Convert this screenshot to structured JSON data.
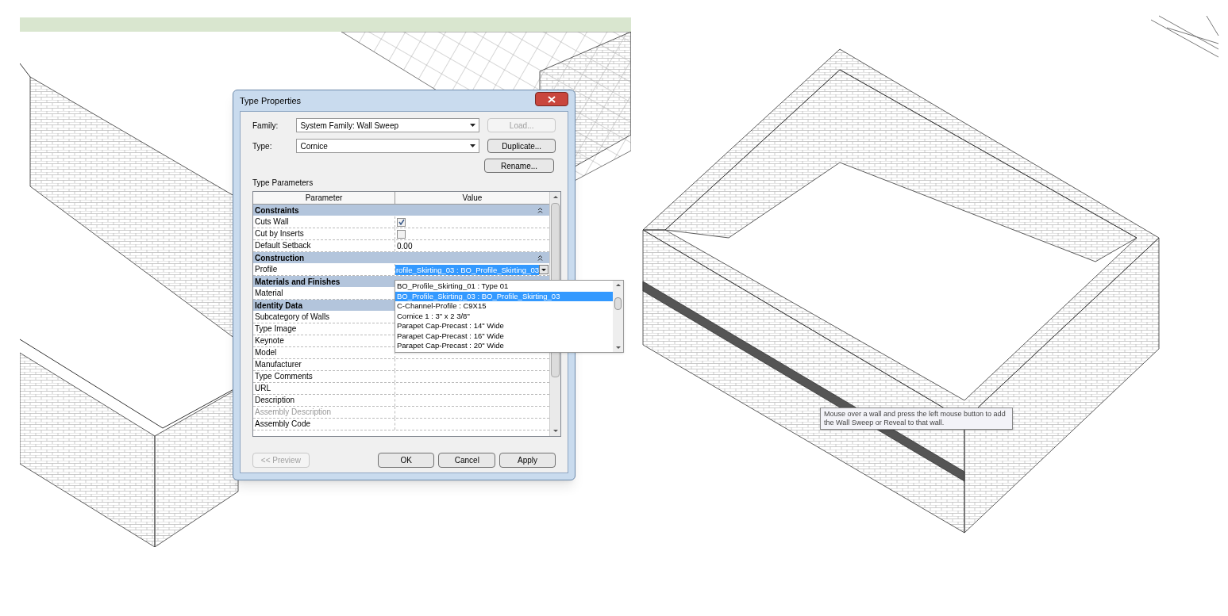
{
  "dialog": {
    "title": "Type Properties",
    "family": {
      "label": "Family:",
      "value": "System Family: Wall Sweep"
    },
    "type": {
      "label": "Type:",
      "value": "Cornice"
    },
    "buttons": [
      {
        "label": "Load...",
        "disabled": true
      },
      {
        "label": "Duplicate...",
        "disabled": false
      },
      {
        "label": "Rename...",
        "disabled": false
      }
    ],
    "section_label": "Type Parameters",
    "table": {
      "columns": [
        "Parameter",
        "Value"
      ],
      "rows": [
        {
          "kind": "group",
          "name": "Constraints",
          "expanded": true,
          "disabled": false
        },
        {
          "kind": "checkbox",
          "name": "Cuts Wall",
          "checked": true,
          "disabled": false
        },
        {
          "kind": "checkbox",
          "name": "Cut by Inserts",
          "checked": false,
          "disabled": false
        },
        {
          "kind": "text",
          "name": "Default Setback",
          "value": "0.00",
          "disabled": false
        },
        {
          "kind": "group",
          "name": "Construction",
          "expanded": true,
          "disabled": false
        },
        {
          "kind": "dropdown",
          "name": "Profile",
          "value": "rofile_Skirting_03 : BO_Profile_Skirting_03",
          "disabled": false
        },
        {
          "kind": "group",
          "name": "Materials and Finishes",
          "disabled": false
        },
        {
          "kind": "text",
          "name": "Material",
          "disabled": false
        },
        {
          "kind": "group",
          "name": "Identity Data",
          "disabled": false
        },
        {
          "kind": "text",
          "name": "Subcategory of Walls",
          "disabled": false
        },
        {
          "kind": "text",
          "name": "Type Image",
          "disabled": false
        },
        {
          "kind": "text",
          "name": "Keynote",
          "disabled": false
        },
        {
          "kind": "text",
          "name": "Model",
          "disabled": false
        },
        {
          "kind": "text",
          "name": "Manufacturer",
          "disabled": false
        },
        {
          "kind": "text",
          "name": "Type Comments",
          "disabled": false
        },
        {
          "kind": "text",
          "name": "URL",
          "disabled": false
        },
        {
          "kind": "text",
          "name": "Description",
          "disabled": false
        },
        {
          "kind": "text",
          "name": "Assembly Description",
          "disabled": true
        },
        {
          "kind": "text",
          "name": "Assembly Code",
          "disabled": false
        }
      ]
    },
    "profile_options": [
      {
        "label": "BO_Profile_Skirting_01 : Type 01",
        "selected": false
      },
      {
        "label": "BO_Profile_Skirting_03 : BO_Profile_Skirting_03",
        "selected": true
      },
      {
        "label": "C-Channel-Profile : C9X15",
        "selected": false
      },
      {
        "label": "Cornice 1 : 3\" x 2 3/8\"",
        "selected": false
      },
      {
        "label": "Parapet Cap-Precast : 14\" Wide",
        "selected": false
      },
      {
        "label": "Parapet Cap-Precast : 16\" Wide",
        "selected": false
      },
      {
        "label": "Parapet Cap-Precast : 20\" Wide",
        "selected": false
      }
    ],
    "footer_buttons": [
      {
        "label": "<< Preview",
        "disabled": true
      },
      {
        "label": "OK",
        "disabled": false
      },
      {
        "label": "Cancel",
        "disabled": false
      },
      {
        "label": "Apply",
        "disabled": false
      }
    ]
  },
  "tooltip": "Mouse over a wall and press the left mouse button to add the Wall Sweep or Reveal to that wall."
}
